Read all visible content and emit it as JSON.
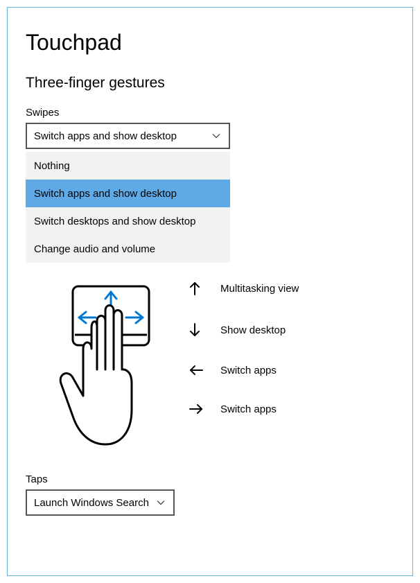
{
  "page_title": "Touchpad",
  "section_title": "Three-finger gestures",
  "swipes": {
    "label": "Swipes",
    "selected": "Switch apps and show desktop",
    "options": [
      "Nothing",
      "Switch apps and show desktop",
      "Switch desktops and show desktop",
      "Change audio and volume"
    ]
  },
  "legend": {
    "up": "Multitasking view",
    "down": "Show desktop",
    "left": "Switch apps",
    "right": "Switch apps"
  },
  "taps": {
    "label": "Taps",
    "selected": "Launch Windows Search"
  },
  "colors": {
    "arrow_blue": "#0078d4",
    "highlight_blue": "#5ea9e6",
    "border_blue": "#62b1e4"
  }
}
